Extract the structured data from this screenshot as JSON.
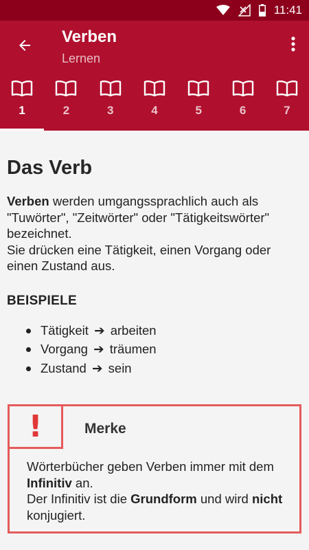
{
  "status_bar": {
    "time": "11:41",
    "icons": [
      "wifi-icon",
      "signal-icon",
      "battery-icon"
    ]
  },
  "app_bar": {
    "title": "Verben",
    "subtitle": "Lernen",
    "back_icon": "arrow-left-icon",
    "menu_icon": "more-vert-icon",
    "accent_color": "#b0102e"
  },
  "tabs": [
    {
      "label": "1",
      "icon": "book-icon",
      "active": true
    },
    {
      "label": "2",
      "icon": "book-icon",
      "active": false
    },
    {
      "label": "3",
      "icon": "book-icon",
      "active": false
    },
    {
      "label": "4",
      "icon": "book-icon",
      "active": false
    },
    {
      "label": "5",
      "icon": "book-icon",
      "active": false
    },
    {
      "label": "6",
      "icon": "book-icon",
      "active": false
    },
    {
      "label": "7",
      "icon": "book-icon",
      "active": false
    }
  ],
  "lesson": {
    "heading": "Das Verb",
    "intro_bold": "Verben",
    "intro_rest1": " werden umgangssprachlich auch als \"Tuwörter\", \"Zeitwörter\" oder \"Tätigkeitswörter\" bezeichnet.",
    "intro_line2": "Sie drücken eine Tätigkeit, einen Vorgang oder einen Zustand aus.",
    "examples_heading": "BEISPIELE",
    "arrow": "➔",
    "examples": [
      {
        "term": "Tätigkeit",
        "example": "arbeiten"
      },
      {
        "term": "Vorgang",
        "example": "träumen"
      },
      {
        "term": "Zustand",
        "example": "sein"
      }
    ]
  },
  "note": {
    "icon": "!",
    "title": "Merke",
    "p1_a": "Wörterbücher geben Verben immer mit dem ",
    "p1_b": "Infinitiv",
    "p1_c": " an.",
    "p2_a": "Der Infinitiv ist die ",
    "p2_b": "Grundform",
    "p2_c": " und wird ",
    "p2_d": "nicht",
    "p2_e": " konjugiert.",
    "border_color": "#e55a5a"
  }
}
